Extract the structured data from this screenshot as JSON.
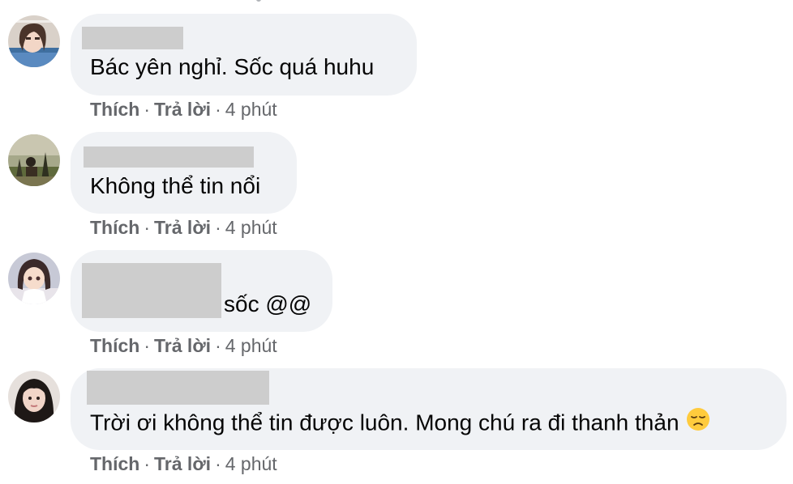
{
  "comments": [
    {
      "text": "Bác yên nghỉ. Sốc quá huhu",
      "like_label": "Thích",
      "reply_label": "Trả lời",
      "time": "4 phút",
      "avatar_icon": "avatar-girl-photo"
    },
    {
      "text": "Không thể tin nổi",
      "like_label": "Thích",
      "reply_label": "Trả lời",
      "time": "4 phút",
      "avatar_icon": "avatar-outdoor-photo"
    },
    {
      "text": "sốc @@",
      "like_label": "Thích",
      "reply_label": "Trả lời",
      "time": "4 phút",
      "avatar_icon": "avatar-anime-girl"
    },
    {
      "text": "Trời ơi không thể tin được luôn. Mong chú ra đi thanh thản",
      "emoji": "disappointed-face-emoji",
      "like_label": "Thích",
      "reply_label": "Trả lời",
      "time": "4 phút",
      "avatar_icon": "avatar-girl-portrait"
    }
  ],
  "separator": "·",
  "colors": {
    "bubble": "#f0f2f5",
    "meta_text": "#65676b",
    "redaction": "#cdcdcd",
    "body_text": "#050505"
  }
}
